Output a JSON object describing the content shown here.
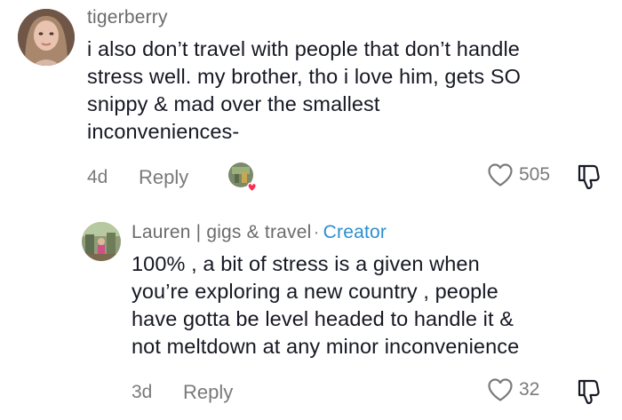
{
  "comments": [
    {
      "username": "tigerberry",
      "text_lines": [
        "i also don’t travel with people that don’t handle",
        "stress well. my brother, tho i love him, gets SO",
        "snippy & mad over the smallest",
        "inconveniences-"
      ],
      "age": "4d",
      "reply_label": "Reply",
      "likes": "505",
      "icons": [
        "heart-outline-icon",
        "thumbs-down-icon",
        "liked-by-creator-heart-icon"
      ]
    },
    {
      "username": "Lauren | gigs & travel",
      "separator": "·",
      "badge": "Creator",
      "text_lines": [
        "100% , a bit of stress is a given when",
        "you’re exploring a new country , people",
        "have gotta be level headed to handle it &",
        "not meltdown at any minor inconvenience"
      ],
      "age": "3d",
      "reply_label": "Reply",
      "likes": "32",
      "icons": [
        "heart-outline-icon",
        "thumbs-down-icon"
      ]
    }
  ],
  "colors": {
    "username": "#6b6b6b",
    "creator": "#2b8fd0",
    "meta": "#7a7a7a",
    "text": "#161823",
    "liked_heart": "#fe2c55"
  }
}
